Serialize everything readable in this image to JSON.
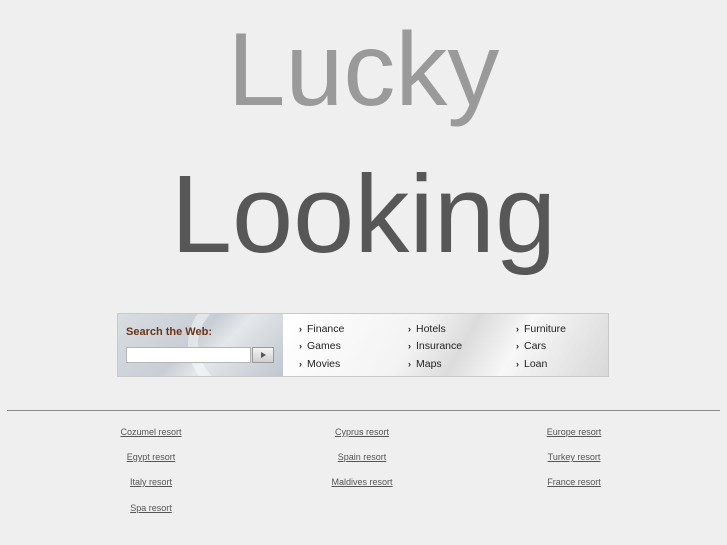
{
  "logo": {
    "line1": "Lucky",
    "line2": "Looking"
  },
  "search": {
    "label": "Search the Web:",
    "input_value": "",
    "button_label": ""
  },
  "categories": {
    "col1": [
      "Finance",
      "Games",
      "Movies"
    ],
    "col2": [
      "Hotels",
      "Insurance",
      "Maps"
    ],
    "col3": [
      "Furniture",
      "Cars",
      "Loan"
    ]
  },
  "resorts": {
    "col1": [
      "Cozumel resort",
      "Egypt resort",
      "Italy resort",
      "Spa resort"
    ],
    "col2": [
      "Cyprus resort",
      "Spain resort",
      "Maldives resort"
    ],
    "col3": [
      "Europe resort",
      "Turkey resort",
      "France resort"
    ]
  },
  "colors": {
    "background": "#efefef",
    "logo_light": "#9a9a9a",
    "logo_dark": "#575757",
    "search_label": "#6a3516"
  }
}
